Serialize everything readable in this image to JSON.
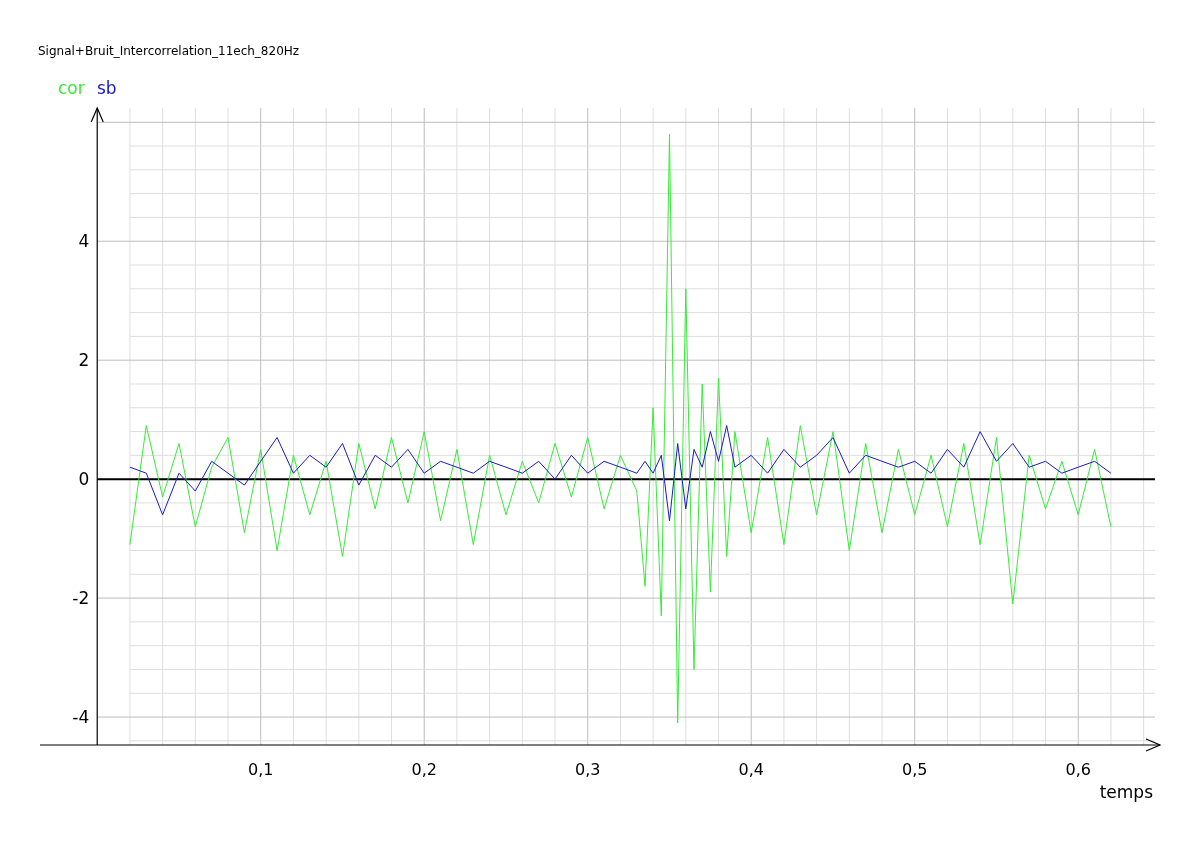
{
  "chart_data": {
    "type": "line",
    "title": "Signal+Bruit_Intercorrelation_11ech_820Hz",
    "xlabel": "temps",
    "x": [
      0.02,
      0.03,
      0.04,
      0.05,
      0.06,
      0.07,
      0.08,
      0.09,
      0.1,
      0.11,
      0.12,
      0.13,
      0.14,
      0.15,
      0.16,
      0.17,
      0.18,
      0.19,
      0.2,
      0.21,
      0.22,
      0.23,
      0.24,
      0.25,
      0.26,
      0.27,
      0.28,
      0.29,
      0.3,
      0.31,
      0.32,
      0.33,
      0.335,
      0.34,
      0.345,
      0.35,
      0.355,
      0.36,
      0.365,
      0.37,
      0.375,
      0.38,
      0.385,
      0.39,
      0.4,
      0.41,
      0.42,
      0.43,
      0.44,
      0.45,
      0.46,
      0.47,
      0.48,
      0.49,
      0.5,
      0.51,
      0.52,
      0.53,
      0.54,
      0.55,
      0.56,
      0.57,
      0.58,
      0.59,
      0.6,
      0.61,
      0.62
    ],
    "series": [
      {
        "name": "cor",
        "color": "#33ee33",
        "values": [
          -1.1,
          0.9,
          -0.3,
          0.6,
          -0.8,
          0.2,
          0.7,
          -0.9,
          0.5,
          -1.2,
          0.4,
          -0.6,
          0.3,
          -1.3,
          0.6,
          -0.5,
          0.7,
          -0.4,
          0.8,
          -0.7,
          0.5,
          -1.1,
          0.4,
          -0.6,
          0.3,
          -0.4,
          0.6,
          -0.3,
          0.7,
          -0.5,
          0.4,
          -0.2,
          -1.8,
          1.2,
          -2.3,
          5.8,
          -4.1,
          3.2,
          -3.2,
          1.6,
          -1.9,
          1.7,
          -1.3,
          0.8,
          -0.9,
          0.7,
          -1.1,
          0.9,
          -0.6,
          0.8,
          -1.2,
          0.6,
          -0.9,
          0.5,
          -0.6,
          0.4,
          -0.8,
          0.6,
          -1.1,
          0.7,
          -2.1,
          0.4,
          -0.5,
          0.3,
          -0.6,
          0.5,
          -0.8
        ]
      },
      {
        "name": "sb",
        "color": "#1a1acc",
        "values": [
          0.2,
          0.1,
          -0.6,
          0.1,
          -0.2,
          0.3,
          0.1,
          -0.1,
          0.3,
          0.7,
          0.1,
          0.4,
          0.2,
          0.6,
          -0.1,
          0.4,
          0.2,
          0.5,
          0.1,
          0.3,
          0.2,
          0.1,
          0.3,
          0.2,
          0.1,
          0.3,
          0.0,
          0.4,
          0.1,
          0.3,
          0.2,
          0.1,
          0.3,
          0.1,
          0.4,
          -0.7,
          0.6,
          -0.5,
          0.5,
          0.2,
          0.8,
          0.3,
          0.9,
          0.2,
          0.4,
          0.1,
          0.5,
          0.2,
          0.4,
          0.7,
          0.1,
          0.4,
          0.3,
          0.2,
          0.3,
          0.1,
          0.5,
          0.2,
          0.8,
          0.3,
          0.6,
          0.2,
          0.3,
          0.1,
          0.2,
          0.3,
          0.1
        ]
      }
    ],
    "xlim": [
      -0.035,
      0.65
    ],
    "ylim": [
      -4.47,
      6.24
    ],
    "xticks": [
      {
        "value": 0.1,
        "label": "0,1"
      },
      {
        "value": 0.2,
        "label": "0,2"
      },
      {
        "value": 0.3,
        "label": "0,3"
      },
      {
        "value": 0.4,
        "label": "0,4"
      },
      {
        "value": 0.5,
        "label": "0,5"
      },
      {
        "value": 0.6,
        "label": "0,6"
      }
    ],
    "yticks": [
      -4,
      -2,
      0,
      2,
      4
    ],
    "grid": true
  }
}
